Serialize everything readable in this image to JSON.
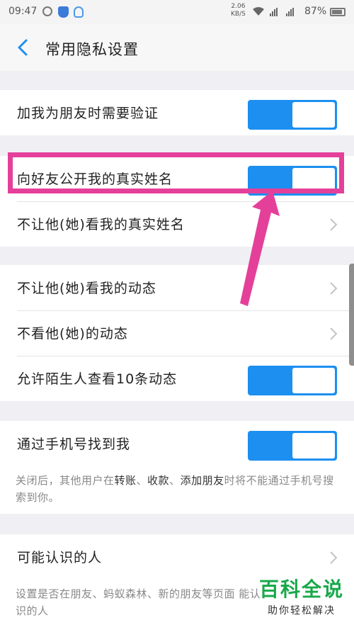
{
  "status_bar": {
    "time": "09:47",
    "speed_value": "2.06",
    "speed_unit": "KB/S",
    "battery": "87%"
  },
  "header": {
    "title": "常用隐私设置"
  },
  "settings": {
    "verify_friend": {
      "label": "加我为朋友时需要验证",
      "on": true
    },
    "show_real_name": {
      "label": "向好友公开我的真实姓名",
      "on": true
    },
    "hide_real_name": {
      "label": "不让他(她)看我的真实姓名"
    },
    "hide_my_moments": {
      "label": "不让他(她)看我的动态"
    },
    "not_see_moments": {
      "label": "不看他(她)的动态"
    },
    "stranger_ten": {
      "label": "允许陌生人查看10条动态",
      "on": true
    },
    "find_by_phone": {
      "label": "通过手机号找到我",
      "on": true
    },
    "phone_note": {
      "part1": "关闭后，其他用户在",
      "kw1": "转账",
      "sep1": "、",
      "kw2": "收款",
      "sep2": "、",
      "kw3": "添加朋友",
      "part2": "时将不能通过手机号搜索到你。"
    },
    "maybe_know": {
      "label": "可能认识的人"
    },
    "maybe_note": "设置是否在朋友、蚂蚁森林、新的朋友等页面 能认识的人"
  },
  "watermark": {
    "main": "百科全说",
    "sub": "助你轻松解决"
  },
  "colors": {
    "toggle_on": "#1c8ff0",
    "annotation": "#e4409a",
    "background": "#efeff4"
  }
}
